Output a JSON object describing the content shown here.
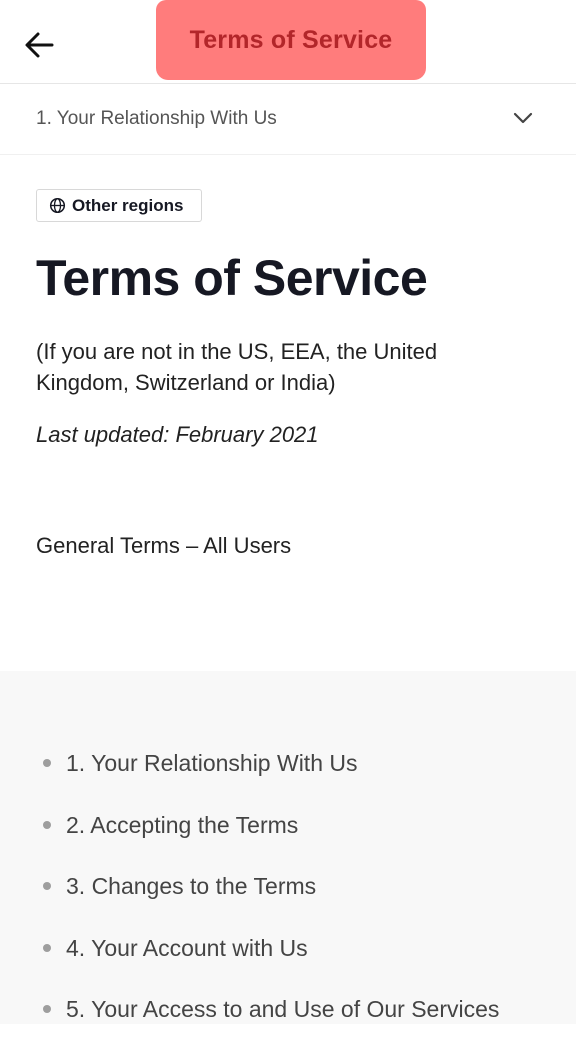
{
  "header": {
    "back_icon": "arrow-left-icon",
    "title": "Terms of Service",
    "title_bg": "#ff7c7c",
    "title_color": "#b2262a"
  },
  "section_selector": {
    "selected": "1. Your Relationship With Us",
    "icon": "chevron-down-icon"
  },
  "content": {
    "region_button": {
      "icon": "globe-icon",
      "label": "Other regions"
    },
    "heading": "Terms of Service",
    "subtitle": "(If you are not in the US, EEA, the United Kingdom, Switzerland or India)",
    "last_updated": "Last updated: February 2021",
    "section_label": "General Terms – All Users"
  },
  "toc": {
    "items": [
      {
        "label": "1. Your Relationship With Us"
      },
      {
        "label": "2. Accepting the Terms"
      },
      {
        "label": "3. Changes to the Terms"
      },
      {
        "label": "4. Your Account with Us"
      },
      {
        "label": "5. Your Access to and Use of Our Services"
      }
    ]
  }
}
